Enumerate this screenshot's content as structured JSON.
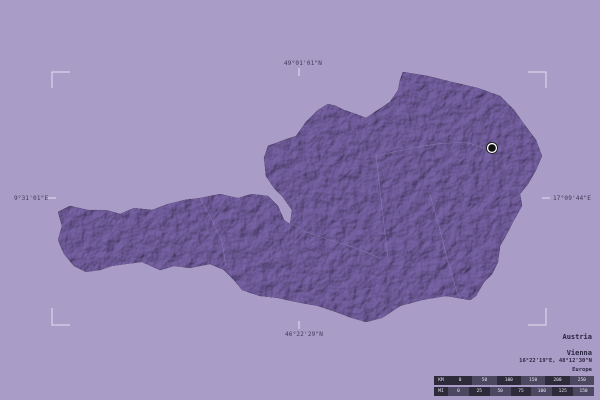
{
  "map": {
    "country": "Austria",
    "capital": "Vienna",
    "capital_coords": "16°22'19\"E, 48°12'30\"N",
    "continent": "Europe",
    "colors": {
      "background": "#a99cc7",
      "landmass": "#7a64a8",
      "frame": "#e4dff0",
      "capital_marker": "#111111"
    }
  },
  "coords": {
    "north": "49°01'01\"N",
    "south": "46°22'29\"N",
    "west": "9°31'01\"E",
    "east": "17°09'44\"E"
  },
  "scalebar": {
    "km_label": "KM",
    "mi_label": "MI",
    "km_ticks": [
      "0",
      "50",
      "100",
      "150",
      "200",
      "250"
    ],
    "mi_ticks": [
      "0",
      "25",
      "50",
      "75",
      "100",
      "125",
      "150"
    ]
  }
}
